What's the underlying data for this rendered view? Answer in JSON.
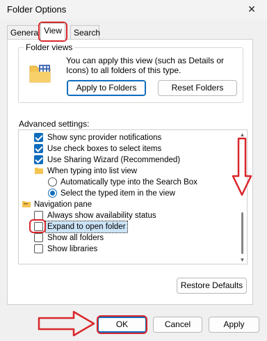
{
  "window": {
    "title": "Folder Options",
    "close_glyph": "✕"
  },
  "tabs": [
    "General",
    "View",
    "Search"
  ],
  "folder_views": {
    "label": "Folder views",
    "description": "You can apply this view (such as Details or Icons) to all folders of this type.",
    "apply_button": "Apply to Folders",
    "reset_button": "Reset Folders"
  },
  "advanced": {
    "label": "Advanced settings:",
    "items": [
      {
        "label": "Show sync provider notifications",
        "kind": "checkbox",
        "checked": true
      },
      {
        "label": "Use check boxes to select items",
        "kind": "checkbox",
        "checked": true
      },
      {
        "label": "Use Sharing Wizard (Recommended)",
        "kind": "checkbox",
        "checked": true
      },
      {
        "label": "When typing into list view",
        "kind": "folder"
      },
      {
        "label": "Automatically type into the Search Box",
        "kind": "radio",
        "checked": false
      },
      {
        "label": "Select the typed item in the view",
        "kind": "radio",
        "checked": true
      },
      {
        "label": "Navigation pane",
        "kind": "folder"
      },
      {
        "label": "Always show availability status",
        "kind": "checkbox",
        "checked": false
      },
      {
        "label": "Expand to open folder",
        "kind": "checkbox",
        "checked": false,
        "selected": true
      },
      {
        "label": "Show all folders",
        "kind": "checkbox",
        "checked": false
      },
      {
        "label": "Show libraries",
        "kind": "checkbox",
        "checked": false
      }
    ]
  },
  "restore_button": "Restore Defaults",
  "footer": {
    "ok": "OK",
    "cancel": "Cancel",
    "apply": "Apply"
  },
  "colors": {
    "accent": "#0f6cbd",
    "annotation": "#d9262b"
  }
}
